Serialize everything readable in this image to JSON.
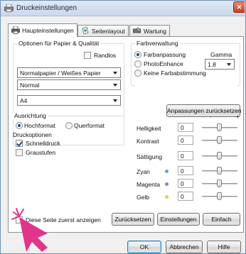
{
  "window": {
    "title": "Druckeinstellungen"
  },
  "tabs": [
    {
      "label": "Haupteinstellungen"
    },
    {
      "label": "Seitenlayout"
    },
    {
      "label": "Wartung"
    }
  ],
  "paper_quality": {
    "group_label": "Optionen für Papier & Qualität",
    "borderless_label": "Randlos",
    "media_type": "Normalpapier / Weißes Papier",
    "quality": "Normal",
    "paper_size": "A4"
  },
  "orientation": {
    "group_label": "Ausrichtung",
    "portrait_label": "Hochformat",
    "landscape_label": "Querformat"
  },
  "print_options": {
    "group_label": "Druckoptionen",
    "fast_print_label": "Schnelldruck",
    "grayscale_label": "Graustufen"
  },
  "color_management": {
    "group_label": "Farbverwaltung",
    "color_adjust_label": "Farbanpassung",
    "photo_enhance_label": "PhotoEnhance",
    "no_color_label": "Keine Farbabstimmung",
    "gamma_label": "Gamma",
    "gamma_value": "1.8",
    "reset_adjust_label": "Anpassungen zurücksetzen",
    "scale_min": "-",
    "scale_max": "+",
    "sliders": [
      {
        "label": "Helligkeit",
        "value": "0",
        "dot": ""
      },
      {
        "label": "Kontrast",
        "value": "0",
        "dot": ""
      },
      {
        "label": "Sättigung",
        "value": "0",
        "dot": ""
      },
      {
        "label": "Zyan",
        "value": "0",
        "dot": "#5aa9c6"
      },
      {
        "label": "Magenta",
        "value": "0",
        "dot": "#a07ad0"
      },
      {
        "label": "Gelb",
        "value": "0",
        "dot": "#d8d84a"
      }
    ]
  },
  "bottom": {
    "preview_label": "Diese Seite zuerst anzeigen",
    "reset_label": "Zurücksetzen",
    "settings_label": "Einstellungen",
    "simple_label": "Einfach"
  },
  "dialog_buttons": {
    "ok": "OK",
    "cancel": "Abbrechen",
    "help": "Hilfe"
  }
}
